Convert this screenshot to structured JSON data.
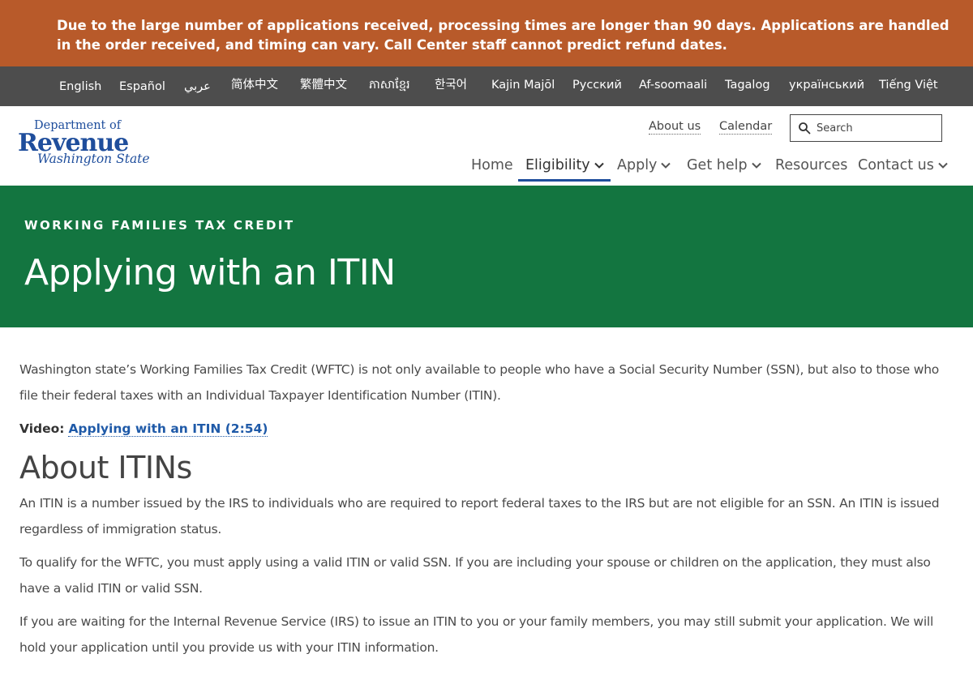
{
  "alert": {
    "text_before": "Due to the large number of applications received, processing times are longer than 90 days. Applications are handled in the order received, and timing can vary. Call Center staff ",
    "text_bold": "cannot",
    "text_after": " predict refund dates."
  },
  "languages": [
    "English",
    "Español",
    "عربي",
    "简体中文",
    "繁體中文",
    "ភាសាខ្មែរ",
    "한국어",
    "Kajin Majōl",
    "Русский",
    "Af-soomaali",
    "Tagalog",
    "український",
    "Tiếng Việt"
  ],
  "logo": {
    "line1": "Department of",
    "line2": "Revenue",
    "line3": "Washington State"
  },
  "utility": {
    "about": "About us",
    "calendar": "Calendar",
    "search_placeholder": "Search"
  },
  "nav": {
    "home": "Home",
    "eligibility": "Eligibility",
    "apply": "Apply",
    "get_help": "Get help",
    "resources": "Resources",
    "contact": "Contact us"
  },
  "hero": {
    "eyebrow": "WORKING FAMILIES TAX CREDIT",
    "title": "Applying with an ITIN"
  },
  "content": {
    "intro": "Washington state’s Working Families Tax Credit (WFTC) is not only available to people who have a Social Security Number (SSN), but also to those who file their federal taxes with an Individual Taxpayer Identification Number (ITIN).",
    "video_label": "Video:",
    "video_link": "Applying with an ITIN (2:54)",
    "heading": "About ITINs",
    "p1": "An ITIN is a number issued by the IRS to individuals who are required to report federal taxes to the IRS but are not eligible for an SSN. An ITIN is issued regardless of immigration status.",
    "p2": "To qualify for the WFTC, you must apply using a valid ITIN or valid SSN. If you are including your spouse or children on the application, they must also have a valid ITIN or valid SSN.",
    "p3": "If you are waiting for the Internal Revenue Service (IRS) to issue an ITIN to you or your family members, you may still submit your application. We will hold your application until you provide us with your ITIN information."
  },
  "colors": {
    "alert_bg": "#b85a2a",
    "lang_bar_bg": "#4d4d4d",
    "hero_bg": "#137540",
    "brand_blue": "#1f4e9c",
    "link_blue": "#1f5aa8"
  }
}
